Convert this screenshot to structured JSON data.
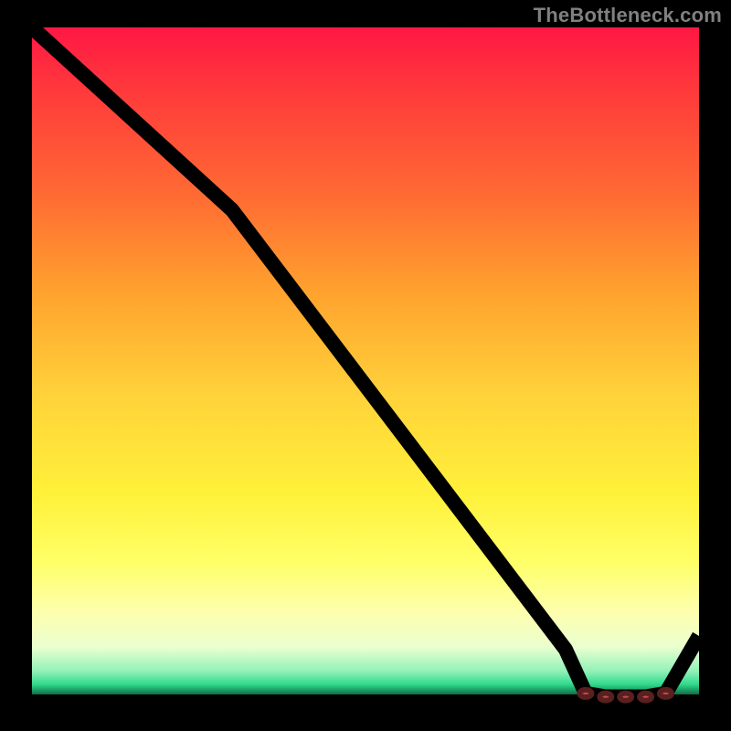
{
  "watermark": "TheBottleneck.com",
  "colors": {
    "bg_black": "#000000",
    "watermark_gray": "#808080",
    "line": "#000000",
    "marker_fill": "#c74a4a",
    "marker_stroke": "#5a1f1f"
  },
  "chart_data": {
    "type": "line",
    "title": "",
    "xlabel": "",
    "ylabel": "",
    "xlim": [
      0,
      100
    ],
    "ylim": [
      0,
      100
    ],
    "grid": false,
    "legend": false,
    "x": [
      0,
      10,
      20,
      30,
      40,
      50,
      60,
      70,
      80,
      83,
      86,
      89,
      92,
      95,
      100
    ],
    "y": [
      100,
      91,
      82,
      73,
      60,
      47,
      34,
      21,
      8,
      1.5,
      1.0,
      1.0,
      1.0,
      1.5,
      10
    ],
    "markers_x": [
      83,
      86,
      89,
      92,
      95
    ],
    "markers_y": [
      1.5,
      1.0,
      1.0,
      1.0,
      1.5
    ],
    "gradient_stops": [
      {
        "pos": 0.0,
        "color": "#ff1744"
      },
      {
        "pos": 0.1,
        "color": "#ff3b3b"
      },
      {
        "pos": 0.25,
        "color": "#ff6a33"
      },
      {
        "pos": 0.4,
        "color": "#ffa32e"
      },
      {
        "pos": 0.55,
        "color": "#ffd23a"
      },
      {
        "pos": 0.7,
        "color": "#fff13a"
      },
      {
        "pos": 0.8,
        "color": "#ffff66"
      },
      {
        "pos": 0.88,
        "color": "#fdffb0"
      },
      {
        "pos": 0.93,
        "color": "#e9ffd0"
      },
      {
        "pos": 0.965,
        "color": "#92f2b8"
      },
      {
        "pos": 0.985,
        "color": "#2fd98c"
      },
      {
        "pos": 1.0,
        "color": "#0e6e46"
      }
    ]
  }
}
